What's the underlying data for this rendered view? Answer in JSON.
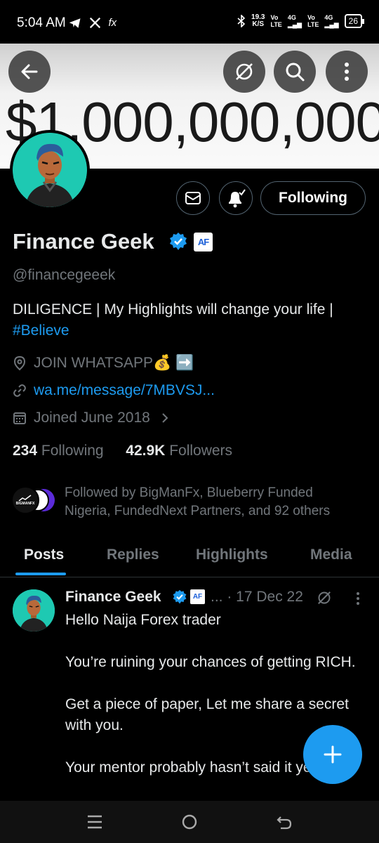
{
  "status_bar": {
    "time": "5:04 AM",
    "left_icons": [
      "telegram-icon",
      "x-icon",
      "fx-icon"
    ],
    "net_speed_value": "19.3",
    "net_speed_unit": "K/S",
    "sim1_top": "Vo",
    "sim1_bottom": "LTE",
    "sim1_gen": "4G",
    "sim2_top": "Vo",
    "sim2_bottom": "LTE",
    "sim2_gen": "4G",
    "battery": "26"
  },
  "header": {
    "banner_text": "$1,000,000,000",
    "back_icon": "arrow-left-icon",
    "grok_icon": "grok-icon",
    "search_icon": "search-icon",
    "more_icon": "more-vertical-icon"
  },
  "profile": {
    "name": "Finance Geek",
    "badge_text": "AF",
    "handle": "@financegeeek",
    "bio_text": "DILIGENCE | My Highlights will change your life |",
    "bio_hashtag": "#Believe",
    "location": "JOIN WHATSAPP💰 ➡️",
    "website": "wa.me/message/7MBVSJ...",
    "joined": "Joined June 2018",
    "following_count": "234",
    "following_label": "Following",
    "followers_count": "42.9K",
    "followers_label": "Followers",
    "followed_by": "Followed by BigManFx, Blueberry Funded Nigeria, FundedNext Partners, and 92 others",
    "follower_avatar_label": "BIGMANFX"
  },
  "actions": {
    "following_button": "Following"
  },
  "tabs": [
    {
      "label": "Posts",
      "active": true
    },
    {
      "label": "Replies",
      "active": false
    },
    {
      "label": "Highlights",
      "active": false
    },
    {
      "label": "Media",
      "active": false
    }
  ],
  "post": {
    "author": "Finance Geek",
    "badge_text": "AF",
    "ellipsis": "...",
    "date": "· 17 Dec 22",
    "lines": [
      "Hello Naija Forex trader",
      "You’re ruining your chances of getting RICH.",
      "Get a piece of paper, Let me share a secret with you.",
      "Your mentor probably hasn’t said it yet"
    ]
  },
  "colors": {
    "accent": "#1d9bf0",
    "background": "#000000",
    "text_primary": "#e7e9ea",
    "text_secondary": "#71767b",
    "avatar_bg": "#1ec9b2"
  }
}
